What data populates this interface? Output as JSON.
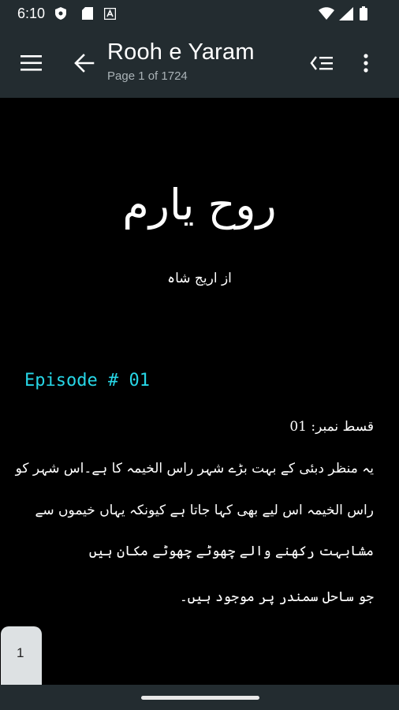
{
  "status_bar": {
    "time": "6:10",
    "icons": [
      "shield-notification-icon",
      "sd-card-icon",
      "app-a-icon",
      "wifi-icon",
      "signal-icon",
      "battery-icon"
    ]
  },
  "app_bar": {
    "title": "Rooh e Yaram",
    "subtitle": "Page 1 of 1724",
    "menu_icon": "hamburger-menu-icon",
    "back_icon": "arrow-left-icon",
    "toc_icon": "table-of-contents-icon",
    "more_icon": "more-vertical-icon"
  },
  "page": {
    "book_title": "روح یارم",
    "author": "از اریج شاہ",
    "episode_heading": "Episode # 01",
    "episode_number_urdu": "قسط نمبر: 01",
    "paragraph_lines": [
      "یہ منظر دبئی کے بہت بڑے شہر راس الخیمہ کا ہے۔اس شہر کو",
      "راس الخیمہ اس لیے بھی کہا جاتا ہے کیونکہ یہاں خیموں سے",
      "مشابہت رکھنے والے چھوٹے چھوٹے مکان ہیں",
      "جو ساحل سمندر پر موجود ہیں۔"
    ]
  },
  "page_tab": {
    "value": "1"
  },
  "colors": {
    "bar_background": "#232c30",
    "page_background": "#000000",
    "episode_accent": "#27d6e6",
    "subtitle_text": "#aab3b7"
  }
}
